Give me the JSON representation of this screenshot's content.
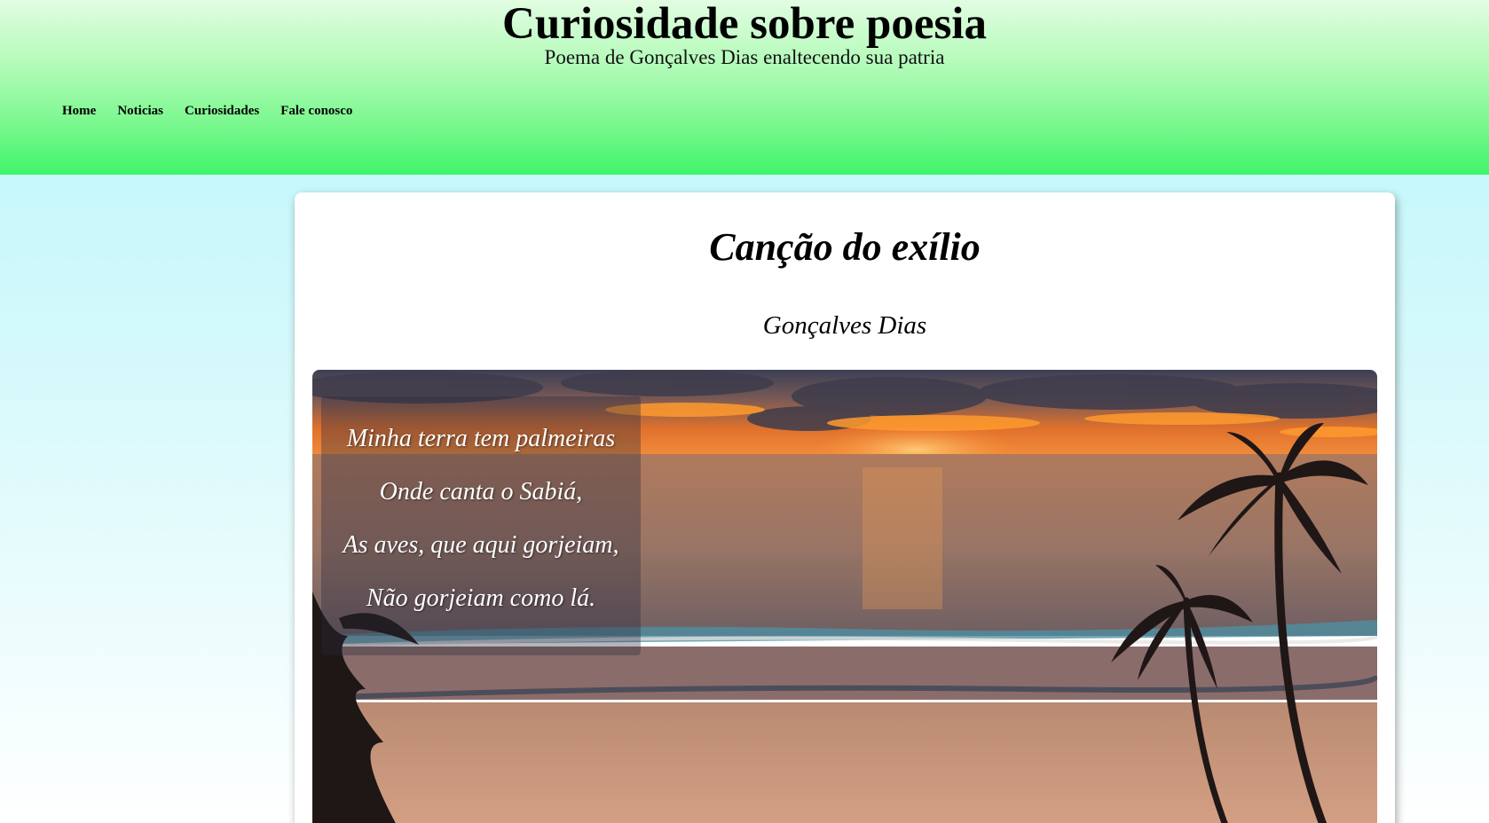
{
  "header": {
    "title": "Curiosidade sobre poesia",
    "subtitle": "Poema de Gonçalves Dias enaltecendo sua patria"
  },
  "nav": {
    "items": [
      "Home",
      "Noticias",
      "Curiosidades",
      "Fale conosco"
    ]
  },
  "poem": {
    "title": "Canção do exílio",
    "author": "Gonçalves Dias",
    "verses": [
      "Minha terra tem palmeiras",
      "Onde canta o Sabiá,",
      "As aves, que aqui gorjeiam,",
      "Não gorjeiam como lá."
    ]
  },
  "colors": {
    "header_top": "#e2fde2",
    "header_bottom": "#3ff46a",
    "page_background": "#b9f7fb",
    "card_background": "#ffffff"
  }
}
